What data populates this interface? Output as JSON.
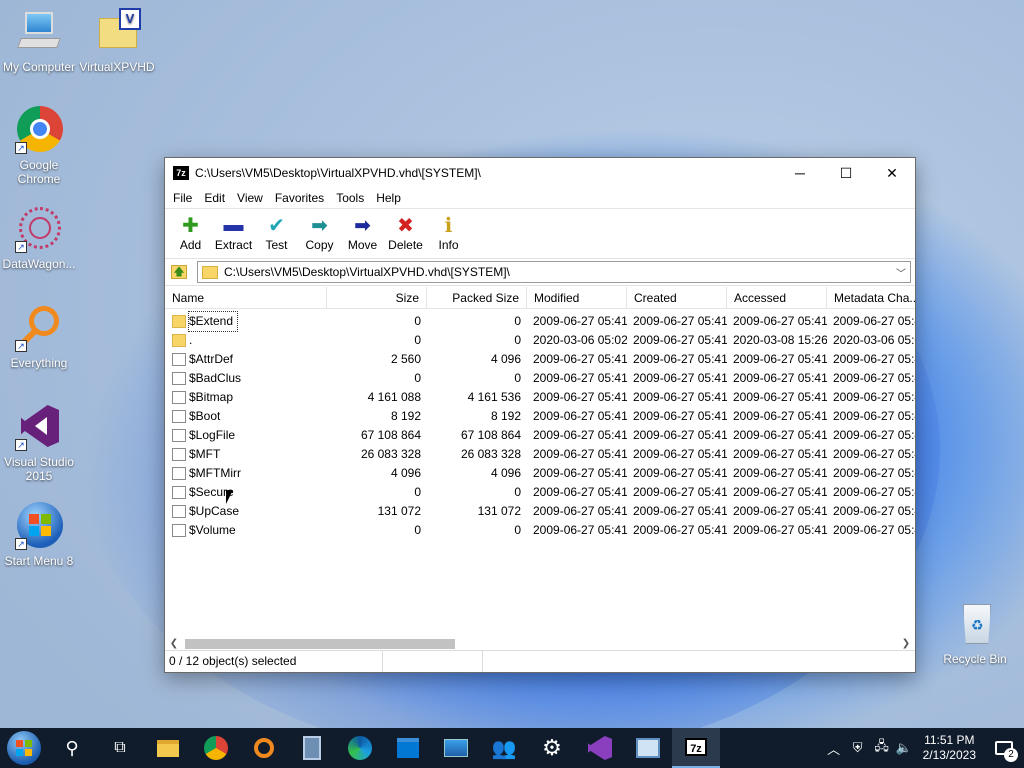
{
  "desktop": {
    "icons": [
      {
        "label": "My Computer",
        "icon": "computer-icon"
      },
      {
        "label": "VirtualXPVHD",
        "icon": "folder-icon"
      },
      {
        "label": "Google Chrome",
        "icon": "chrome-icon"
      },
      {
        "label": "DataWagon...",
        "icon": "datawagon-icon"
      },
      {
        "label": "Everything",
        "icon": "everything-icon"
      },
      {
        "label": "Visual Studio 2015",
        "icon": "visual-studio-icon"
      },
      {
        "label": "Start Menu 8",
        "icon": "start-menu-icon"
      },
      {
        "label": "Recycle Bin",
        "icon": "recycle-bin-icon"
      }
    ]
  },
  "window": {
    "title": "C:\\Users\\VM5\\Desktop\\VirtualXPVHD.vhd\\[SYSTEM]\\",
    "app_icon_text": "7z",
    "controls": {
      "minimize": "─",
      "maximize": "☐",
      "close": "✕"
    },
    "menu": [
      "File",
      "Edit",
      "View",
      "Favorites",
      "Tools",
      "Help"
    ],
    "toolbar": [
      {
        "label": "Add",
        "icon": "add-icon",
        "color": "#2e9b1e",
        "glyph": "✚"
      },
      {
        "label": "Extract",
        "icon": "extract-icon",
        "color": "#2434a8",
        "glyph": "▬"
      },
      {
        "label": "Test",
        "icon": "test-icon",
        "color": "#22a6b6",
        "glyph": "✔"
      },
      {
        "label": "Copy",
        "icon": "copy-icon",
        "color": "#1f8f96",
        "glyph": "➡"
      },
      {
        "label": "Move",
        "icon": "move-icon",
        "color": "#1d2a9c",
        "glyph": "➡"
      },
      {
        "label": "Delete",
        "icon": "delete-icon",
        "color": "#d22222",
        "glyph": "✖"
      },
      {
        "label": "Info",
        "icon": "info-icon",
        "color": "#c8a21a",
        "glyph": "ℹ"
      }
    ],
    "address": "C:\\Users\\VM5\\Desktop\\VirtualXPVHD.vhd\\[SYSTEM]\\",
    "columns": [
      "Name",
      "Size",
      "Packed Size",
      "Modified",
      "Created",
      "Accessed",
      "Metadata Cha..."
    ],
    "rows": [
      {
        "name": "$Extend",
        "type": "folder",
        "size": "0",
        "packed": "0",
        "modified": "2009-06-27 05:41",
        "created": "2009-06-27 05:41",
        "accessed": "2009-06-27 05:41",
        "meta": "2009-06-27 05:4"
      },
      {
        "name": ".",
        "type": "folder",
        "size": "0",
        "packed": "0",
        "modified": "2020-03-06 05:02",
        "created": "2009-06-27 05:41",
        "accessed": "2020-03-08 15:26",
        "meta": "2020-03-06 05:0"
      },
      {
        "name": "$AttrDef",
        "type": "file",
        "size": "2 560",
        "packed": "4 096",
        "modified": "2009-06-27 05:41",
        "created": "2009-06-27 05:41",
        "accessed": "2009-06-27 05:41",
        "meta": "2009-06-27 05:4"
      },
      {
        "name": "$BadClus",
        "type": "file",
        "size": "0",
        "packed": "0",
        "modified": "2009-06-27 05:41",
        "created": "2009-06-27 05:41",
        "accessed": "2009-06-27 05:41",
        "meta": "2009-06-27 05:4"
      },
      {
        "name": "$Bitmap",
        "type": "file",
        "size": "4 161 088",
        "packed": "4 161 536",
        "modified": "2009-06-27 05:41",
        "created": "2009-06-27 05:41",
        "accessed": "2009-06-27 05:41",
        "meta": "2009-06-27 05:4"
      },
      {
        "name": "$Boot",
        "type": "file",
        "size": "8 192",
        "packed": "8 192",
        "modified": "2009-06-27 05:41",
        "created": "2009-06-27 05:41",
        "accessed": "2009-06-27 05:41",
        "meta": "2009-06-27 05:4"
      },
      {
        "name": "$LogFile",
        "type": "file",
        "size": "67 108 864",
        "packed": "67 108 864",
        "modified": "2009-06-27 05:41",
        "created": "2009-06-27 05:41",
        "accessed": "2009-06-27 05:41",
        "meta": "2009-06-27 05:4"
      },
      {
        "name": "$MFT",
        "type": "file",
        "size": "26 083 328",
        "packed": "26 083 328",
        "modified": "2009-06-27 05:41",
        "created": "2009-06-27 05:41",
        "accessed": "2009-06-27 05:41",
        "meta": "2009-06-27 05:4"
      },
      {
        "name": "$MFTMirr",
        "type": "file",
        "size": "4 096",
        "packed": "4 096",
        "modified": "2009-06-27 05:41",
        "created": "2009-06-27 05:41",
        "accessed": "2009-06-27 05:41",
        "meta": "2009-06-27 05:4"
      },
      {
        "name": "$Secure",
        "type": "file",
        "size": "0",
        "packed": "0",
        "modified": "2009-06-27 05:41",
        "created": "2009-06-27 05:41",
        "accessed": "2009-06-27 05:41",
        "meta": "2009-06-27 05:4"
      },
      {
        "name": "$UpCase",
        "type": "file",
        "size": "131 072",
        "packed": "131 072",
        "modified": "2009-06-27 05:41",
        "created": "2009-06-27 05:41",
        "accessed": "2009-06-27 05:41",
        "meta": "2009-06-27 05:4"
      },
      {
        "name": "$Volume",
        "type": "file",
        "size": "0",
        "packed": "0",
        "modified": "2009-06-27 05:41",
        "created": "2009-06-27 05:41",
        "accessed": "2009-06-27 05:41",
        "meta": "2009-06-27 05:4"
      }
    ],
    "status": "0 / 12 object(s) selected"
  },
  "taskbar": {
    "items": [
      "start-orb-icon",
      "search-icon",
      "task-view-icon",
      "file-explorer-icon",
      "chrome-icon",
      "everything-icon",
      "calculator-icon",
      "edge-icon",
      "store-icon",
      "photos-icon",
      "people-icon",
      "settings-icon",
      "visual-studio-icon",
      "remote-desktop-icon",
      "7zip-icon"
    ],
    "time": "11:51 PM",
    "date": "2/13/2023",
    "notification_count": "2"
  }
}
